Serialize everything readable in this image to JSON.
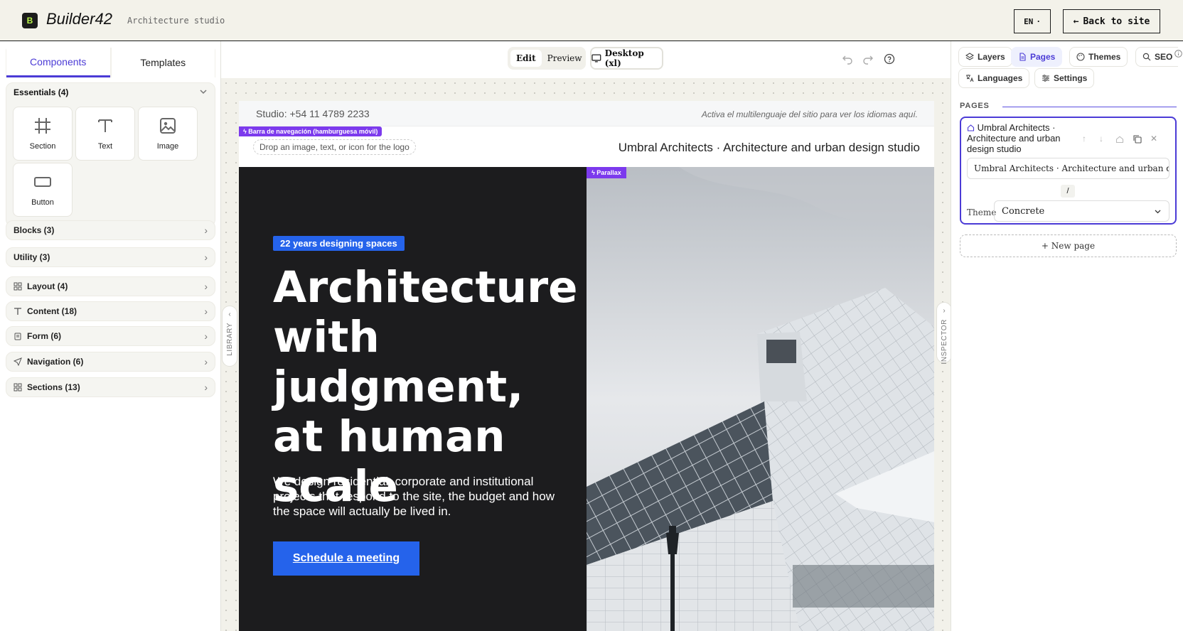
{
  "header": {
    "logo_letter": "B",
    "app_name": "Builder42",
    "subtitle": "Architecture studio",
    "lang_label": "EN",
    "lang_arrow": "·",
    "back_arrow": "←",
    "back_label": "Back to site"
  },
  "library": {
    "tabs": [
      {
        "label": "Components",
        "active": true
      },
      {
        "label": "Templates",
        "active": false
      }
    ],
    "essentials": {
      "title": "Essentials (4)",
      "items": [
        {
          "label": "Section",
          "icon": "grid-hash-icon"
        },
        {
          "label": "Text",
          "icon": "text-t-icon"
        },
        {
          "label": "Image",
          "icon": "image-icon"
        },
        {
          "label": "Button",
          "icon": "button-icon"
        }
      ]
    },
    "groups": [
      {
        "label": "Blocks (3)"
      },
      {
        "label": "Utility (3)"
      },
      {
        "label": "Layout (4)",
        "icon": "layout-grid-icon"
      },
      {
        "label": "Content (18)",
        "icon": "text-t-icon"
      },
      {
        "label": "Form (6)",
        "icon": "clipboard-icon"
      },
      {
        "label": "Navigation (6)",
        "icon": "navigation-arrow-icon"
      },
      {
        "label": "Sections (13)",
        "icon": "sections-grid-icon"
      }
    ],
    "handle_label": "LIBRARY"
  },
  "canvas_toolbar": {
    "edit": "Edit",
    "preview": "Preview",
    "device": "Desktop (xl)"
  },
  "site": {
    "phone": "Studio: +54 11 4789 2233",
    "lang_note": "Activa el multilenguaje del sitio para ver los idiomas aquí.",
    "nav_badge": "Barra de navegación (hamburguesa móvil)",
    "logo_drop": "Drop an image, text, or icon for the logo",
    "nav_title": "Umbral Architects · Architecture and urban design studio",
    "years_badge": "22 years designing spaces",
    "hero_title": "Architecture with judgment, at human scale",
    "hero_sub": "We design residential, corporate and institutional projects that respond to the site, the budget and how the space will actually be lived in.",
    "cta": "Schedule a meeting",
    "parallax_badge": "Parallax"
  },
  "inspector": {
    "handle_label": "INSPECTOR",
    "tabs": [
      {
        "label": "Layers",
        "icon": "layers-icon"
      },
      {
        "label": "Pages",
        "icon": "page-icon",
        "active": true
      },
      {
        "label": "Themes",
        "icon": "palette-icon"
      },
      {
        "label": "SEO",
        "icon": "search-icon"
      },
      {
        "label": "Languages",
        "icon": "translate-icon"
      },
      {
        "label": "Settings",
        "icon": "sliders-icon"
      }
    ],
    "pages_label": "PAGES",
    "page": {
      "name": "Umbral Architects · Architecture and urban design studio",
      "title_value": "Umbral Architects · Architecture and urban design studio",
      "slug": "/",
      "theme_label": "Theme",
      "theme_value": "Concrete"
    },
    "new_page": "+ New page"
  },
  "colors": {
    "accent": "#4b3bd6",
    "brand_blue": "#2563eb",
    "badge_purple": "#7c3aed",
    "hero_dark": "#1c1c1e",
    "app_bg": "#f2f1ea"
  }
}
